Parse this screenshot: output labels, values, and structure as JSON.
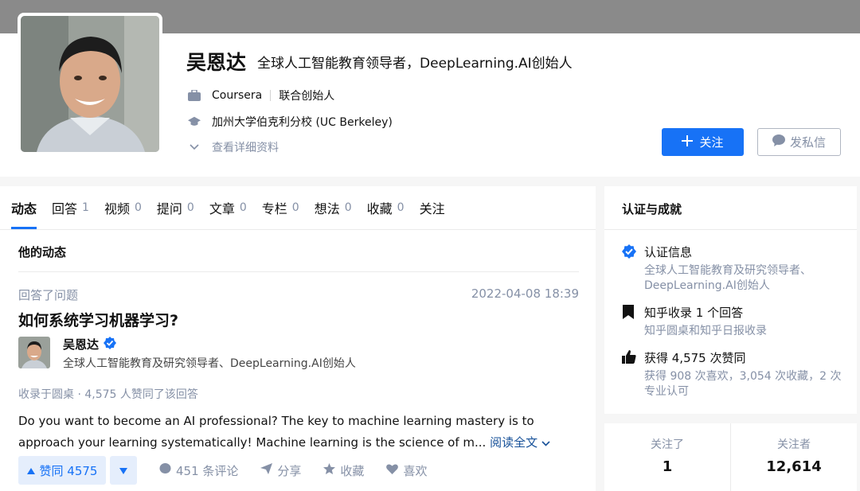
{
  "profile": {
    "name": "吴恩达",
    "headline": "全球人工智能教育领导者，DeepLearning.AI创始人",
    "company": "Coursera",
    "position": "联合创始人",
    "school": "加州大学伯克利分校 (UC Berkeley)",
    "more_label": "查看详细资料",
    "follow_label": "关注",
    "message_label": "发私信"
  },
  "tabs": [
    {
      "label": "动态",
      "count": ""
    },
    {
      "label": "回答",
      "count": "1"
    },
    {
      "label": "视频",
      "count": "0"
    },
    {
      "label": "提问",
      "count": "0"
    },
    {
      "label": "文章",
      "count": "0"
    },
    {
      "label": "专栏",
      "count": "0"
    },
    {
      "label": "想法",
      "count": "0"
    },
    {
      "label": "收藏",
      "count": "0"
    },
    {
      "label": "关注",
      "count": ""
    }
  ],
  "feed": {
    "section_title": "他的动态",
    "activity_type": "回答了问题",
    "time": "2022-04-08 18:39",
    "question_title": "如何系统学习机器学习?",
    "author_name": "吴恩达",
    "author_bio": "全球人工智能教育及研究领导者、DeepLearning.AI创始人",
    "collect_meta": "收录于圆桌 · 4,575 人赞同了该回答",
    "excerpt": "Do you want to become an AI professional? The key to machine learning mastery is to approach your learning systematically! Machine learning is the science of m...",
    "read_more": "阅读全文",
    "vote_label": "赞同 4575",
    "comments": "451 条评论",
    "share": "分享",
    "favorite": "收藏",
    "like": "喜欢"
  },
  "achievements": {
    "title": "认证与成就",
    "verified_title": "认证信息",
    "verified_desc": "全球人工智能教育及研究领导者、DeepLearning.AI创始人",
    "collected_title": "知乎收录 1 个回答",
    "collected_desc": "知乎圆桌和知乎日报收录",
    "upvotes_title": "获得 4,575 次赞同",
    "upvotes_desc": "获得 908 次喜欢，3,054 次收藏，2 次专业认可"
  },
  "follow_stats": {
    "following_label": "关注了",
    "following_count": "1",
    "followers_label": "关注者",
    "followers_count": "12,614"
  },
  "colors": {
    "accent": "#1772f6",
    "verified": "#1772f6",
    "meta_gray": "#8590a6",
    "link": "#175199"
  },
  "icons": [
    "briefcase-icon",
    "graduation-cap-icon",
    "chevron-down-icon",
    "plus-icon",
    "chat-bubble-icon",
    "verified-badge-icon",
    "bookmark-icon",
    "thumbs-up-icon",
    "triangle-up-icon",
    "triangle-down-icon",
    "comment-icon",
    "paper-plane-icon",
    "star-icon",
    "heart-icon"
  ]
}
